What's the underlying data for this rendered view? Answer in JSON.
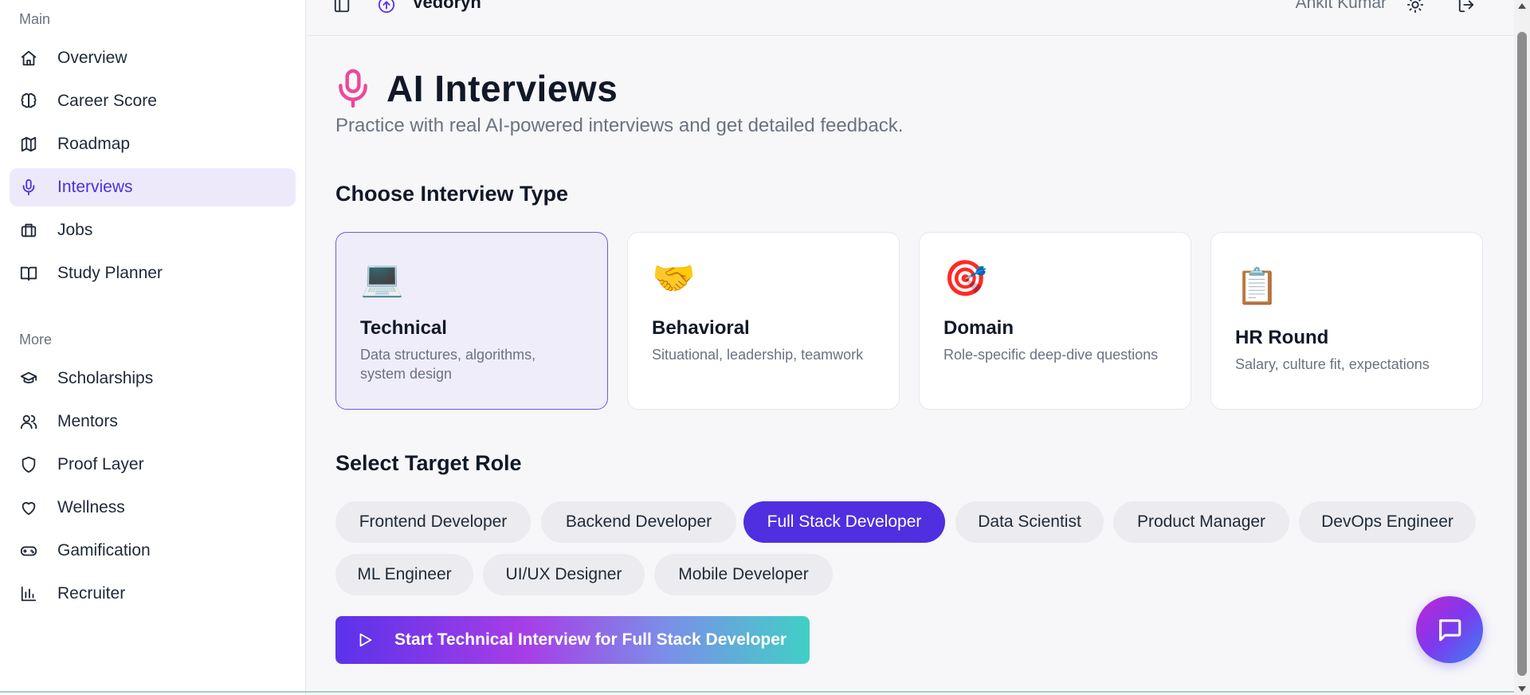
{
  "sidebar": {
    "section_main": "Main",
    "section_more": "More",
    "main_items": [
      {
        "label": "Overview",
        "icon": "home-icon"
      },
      {
        "label": "Career Score",
        "icon": "brain-icon"
      },
      {
        "label": "Roadmap",
        "icon": "map-icon"
      },
      {
        "label": "Interviews",
        "icon": "mic-icon",
        "active": true
      },
      {
        "label": "Jobs",
        "icon": "briefcase-icon"
      },
      {
        "label": "Study Planner",
        "icon": "book-icon"
      }
    ],
    "more_items": [
      {
        "label": "Scholarships",
        "icon": "graduation-cap-icon"
      },
      {
        "label": "Mentors",
        "icon": "users-icon"
      },
      {
        "label": "Proof Layer",
        "icon": "shield-icon"
      },
      {
        "label": "Wellness",
        "icon": "heart-icon"
      },
      {
        "label": "Gamification",
        "icon": "gamepad-icon"
      },
      {
        "label": "Recruiter",
        "icon": "bar-chart-icon"
      }
    ]
  },
  "topbar": {
    "brand": "Vedoryn",
    "user_name": "Ankit Kumar",
    "icons": [
      "sidebar-toggle-icon",
      "logo-icon",
      "sun-icon",
      "logout-icon"
    ]
  },
  "page": {
    "title": "AI Interviews",
    "subtitle": "Practice with real AI-powered interviews and get detailed feedback.",
    "type_heading": "Choose Interview Type",
    "role_heading": "Select Target Role"
  },
  "interview_types": [
    {
      "emoji": "💻",
      "title": "Technical",
      "desc": "Data structures, algorithms, system design",
      "selected": true
    },
    {
      "emoji": "🤝",
      "title": "Behavioral",
      "desc": "Situational, leadership, teamwork"
    },
    {
      "emoji": "🎯",
      "title": "Domain",
      "desc": "Role-specific deep-dive questions"
    },
    {
      "emoji": "📋",
      "title": "HR Round",
      "desc": "Salary, culture fit, expectations"
    }
  ],
  "roles": [
    {
      "label": "Frontend Developer"
    },
    {
      "label": "Backend Developer"
    },
    {
      "label": "Full Stack Developer",
      "selected": true
    },
    {
      "label": "Data Scientist"
    },
    {
      "label": "Product Manager"
    },
    {
      "label": "DevOps Engineer"
    },
    {
      "label": "ML Engineer"
    },
    {
      "label": "UI/UX Designer"
    },
    {
      "label": "Mobile Developer"
    }
  ],
  "start_button": {
    "label": "Start Technical Interview for Full Stack Developer",
    "icon": "play-icon"
  },
  "chat_fab": {
    "icon": "chat-icon"
  },
  "colors": {
    "accent": "#4f2fe0",
    "active_bg": "#ede9fb",
    "mic": "#ec4899"
  }
}
